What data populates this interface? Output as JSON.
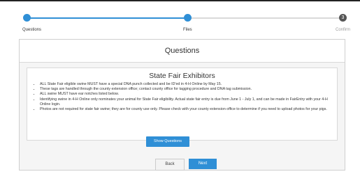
{
  "steps": [
    {
      "label": "Questions",
      "state": "complete"
    },
    {
      "label": "Files",
      "state": "current"
    },
    {
      "label": "Confirm",
      "state": "upcoming",
      "number": "3"
    }
  ],
  "panel": {
    "title": "Questions",
    "notice": {
      "title": "State Fair Exhibitors",
      "items": [
        "ALL State Fair eligible swine MUST have a special DNA punch collected and be ID'ed in 4-H Online by May 15.",
        "These tags are handled through the county extension office; contact county office for tagging procedure and DNA tag submission.",
        "ALL swine MUST have ear notches listed below.",
        "Identifying swine in 4-H Online only nominates your animal for State Fair eligibility. Actual state fair entry is due from June 1 - July 1, and can be made in FairEntry with your 4-H Online login.",
        "Photos are not required for state fair swine; they are for county use only. Please check with your county extension office to determine if you need to upload photos for your pigs."
      ]
    },
    "show_questions_label": "Show Questions"
  },
  "nav": {
    "back_label": "Back",
    "next_label": "Next"
  },
  "colors": {
    "accent": "#2f8fd6",
    "inactive_step": "#555555"
  }
}
